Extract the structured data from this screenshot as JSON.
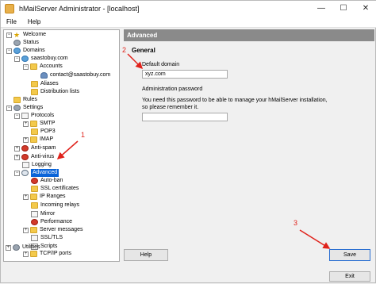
{
  "window": {
    "title": "hMailServer Administrator - [localhost]"
  },
  "window_controls": {
    "minimize": "—",
    "maximize": "☐",
    "close": "✕"
  },
  "menu": {
    "file": "File",
    "help": "Help"
  },
  "tree": {
    "welcome": "Welcome",
    "status": "Status",
    "domains": "Domains",
    "domain_name": "saastobuy.com",
    "accounts": "Accounts",
    "account_email": "contact@saastobuy.com",
    "aliases": "Aliases",
    "distribution_lists": "Distribution lists",
    "rules": "Rules",
    "settings": "Settings",
    "protocols": "Protocols",
    "smtp": "SMTP",
    "pop3": "POP3",
    "imap": "IMAP",
    "anti_spam": "Anti-spam",
    "anti_virus": "Anti-virus",
    "logging": "Logging",
    "advanced": "Advanced",
    "auto_ban": "Auto-ban",
    "ssl_certificates": "SSL certificates",
    "ip_ranges": "IP Ranges",
    "incoming_relays": "Incoming relays",
    "mirror": "Mirror",
    "performance": "Performance",
    "server_messages": "Server messages",
    "ssl_tls": "SSL/TLS",
    "scripts": "Scripts",
    "tcp_ip_ports": "TCP/IP ports",
    "utilities": "Utilities"
  },
  "panel": {
    "header": "Advanced",
    "section": "General",
    "default_domain_label": "Default domain",
    "default_domain_value": "xyz.com",
    "admin_password_label": "Administration password",
    "admin_password_note_1": "You need this password to be able to manage your hMailServer installation,",
    "admin_password_note_2": "so please remember it.",
    "admin_password_value": ""
  },
  "buttons": {
    "help": "Help",
    "save": "Save",
    "exit": "Exit"
  },
  "annotations": {
    "one": "1",
    "two": "2",
    "three": "3"
  },
  "colors": {
    "selection": "#0a64d8",
    "annotation": "#e0221b",
    "header": "#8a8a8a"
  }
}
